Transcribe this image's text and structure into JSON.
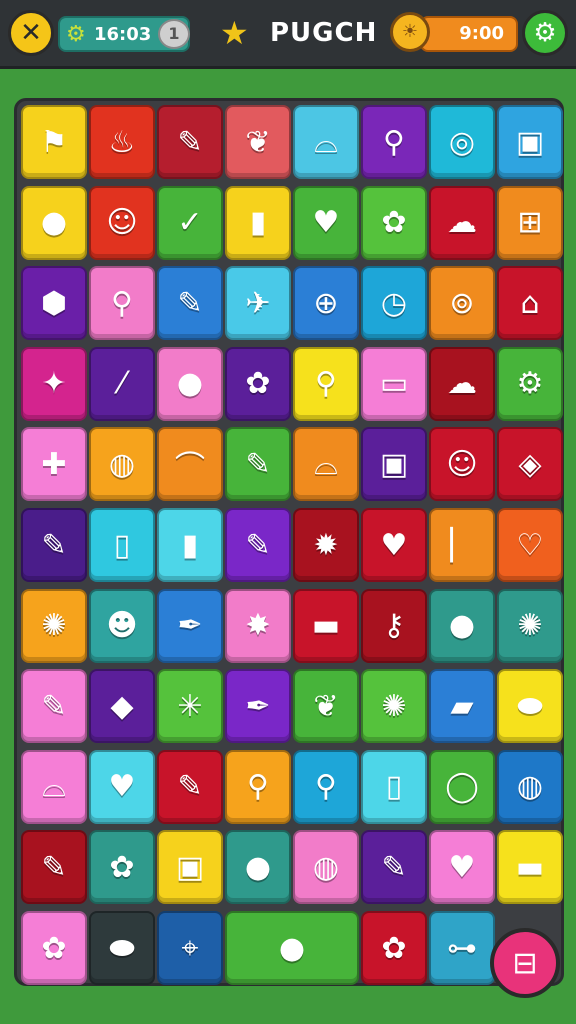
{
  "header": {
    "close_icon": "✕",
    "counter_value": "16:03",
    "counter_badge": "1",
    "title": "PUGCH",
    "timer_value": "9:00",
    "settings_icon": "⚙"
  },
  "board": {
    "rows": [
      [
        {
          "color": "#f6d21c",
          "icon": "flag-icon",
          "glyph": "⚑"
        },
        {
          "color": "#e1331f",
          "icon": "flame-icon",
          "glyph": "♨"
        },
        {
          "color": "#b51e2e",
          "icon": "pencil-icon",
          "glyph": "✎"
        },
        {
          "color": "#e25a5e",
          "icon": "leaf-icon",
          "glyph": "❦"
        },
        {
          "color": "#4cc6e4",
          "icon": "shoe-icon",
          "glyph": "⌓"
        },
        {
          "color": "#7a27b8",
          "icon": "wand-icon",
          "glyph": "⚲"
        },
        {
          "color": "#1fb9d8",
          "icon": "target-icon",
          "glyph": "◎"
        },
        {
          "color": "#2fa4e0",
          "icon": "bag-icon",
          "glyph": "▣"
        }
      ],
      [
        {
          "color": "#f6d21c",
          "icon": "paddle-icon",
          "glyph": "●"
        },
        {
          "color": "#e1331f",
          "icon": "smile-icon",
          "glyph": "☺"
        },
        {
          "color": "#47b43a",
          "icon": "check-bubble-icon",
          "glyph": "✓"
        },
        {
          "color": "#f6d21c",
          "icon": "bottle-icon",
          "glyph": "▮"
        },
        {
          "color": "#47b43a",
          "icon": "apple-icon",
          "glyph": "♥"
        },
        {
          "color": "#55c23c",
          "icon": "cup-icon",
          "glyph": "✿"
        },
        {
          "color": "#c8142a",
          "icon": "cloud-icon",
          "glyph": "☁"
        },
        {
          "color": "#f08b1e",
          "icon": "briefcase-icon",
          "glyph": "⊞"
        }
      ],
      [
        {
          "color": "#6a1fa8",
          "icon": "hexagon-icon",
          "glyph": "⬢"
        },
        {
          "color": "#f27cc9",
          "icon": "magnifier-icon",
          "glyph": "⚲"
        },
        {
          "color": "#2b7fd6",
          "icon": "pencil-icon",
          "glyph": "✎"
        },
        {
          "color": "#49c9e8",
          "icon": "carrot-icon",
          "glyph": "✈"
        },
        {
          "color": "#2b7fd6",
          "icon": "racket-icon",
          "glyph": "⊕"
        },
        {
          "color": "#1ea6d8",
          "icon": "clock-icon",
          "glyph": "◷"
        },
        {
          "color": "#f08b1e",
          "icon": "coffee-icon",
          "glyph": "⊚"
        },
        {
          "color": "#c8142a",
          "icon": "lock-icon",
          "glyph": "⌂"
        }
      ],
      [
        {
          "color": "#d4248e",
          "icon": "puzzle-icon",
          "glyph": "✦"
        },
        {
          "color": "#5b1f9a",
          "icon": "wand-icon",
          "glyph": "⁄"
        },
        {
          "color": "#f27cc9",
          "icon": "apple-icon",
          "glyph": "●"
        },
        {
          "color": "#5b1f9a",
          "icon": "flower-icon",
          "glyph": "✿"
        },
        {
          "color": "#f6e11c",
          "icon": "magnifier-icon",
          "glyph": "⚲"
        },
        {
          "color": "#f57ed6",
          "icon": "speech-bubble-icon",
          "glyph": "▭"
        },
        {
          "color": "#a8121f",
          "icon": "cloud-icon",
          "glyph": "☁"
        },
        {
          "color": "#47b43a",
          "icon": "gear-icon",
          "glyph": "⚙"
        }
      ],
      [
        {
          "color": "#f57ed6",
          "icon": "bandage-icon",
          "glyph": "✚"
        },
        {
          "color": "#f6a31c",
          "icon": "ball-icon",
          "glyph": "◍"
        },
        {
          "color": "#f08b1e",
          "icon": "swoosh-icon",
          "glyph": "⌒"
        },
        {
          "color": "#47b43a",
          "icon": "pencil-icon",
          "glyph": "✎"
        },
        {
          "color": "#f08b1e",
          "icon": "sock-icon",
          "glyph": "⌓"
        },
        {
          "color": "#5b1f9a",
          "icon": "toaster-icon",
          "glyph": "▣"
        },
        {
          "color": "#c8142a",
          "icon": "smile-icon",
          "glyph": "☺"
        },
        {
          "color": "#c8142a",
          "icon": "tag-icon",
          "glyph": "◈"
        }
      ],
      [
        {
          "color": "#4a1d8a",
          "icon": "pencil-icon",
          "glyph": "✎"
        },
        {
          "color": "#2fc8e0",
          "icon": "cup-icon",
          "glyph": "▯"
        },
        {
          "color": "#4dd6e8",
          "icon": "capsule-icon",
          "glyph": "▮"
        },
        {
          "color": "#7a27c8",
          "icon": "pencil-icon",
          "glyph": "✎"
        },
        {
          "color": "#a8121f",
          "icon": "bulb-icon",
          "glyph": "✹"
        },
        {
          "color": "#c8142a",
          "icon": "heart-icon",
          "glyph": "♥"
        },
        {
          "color": "#f08b1e",
          "icon": "pen-icon",
          "glyph": "▏"
        },
        {
          "color": "#f0601e",
          "icon": "heart-icon",
          "glyph": "♡"
        }
      ],
      [
        {
          "color": "#f6a31c",
          "icon": "gear-icon",
          "glyph": "✺"
        },
        {
          "color": "#2fa4a0",
          "icon": "face-icon",
          "glyph": "☻"
        },
        {
          "color": "#2b7fd6",
          "icon": "feather-icon",
          "glyph": "✒"
        },
        {
          "color": "#f27cc9",
          "icon": "splat-icon",
          "glyph": "✸"
        },
        {
          "color": "#c8142a",
          "icon": "folder-icon",
          "glyph": "▬"
        },
        {
          "color": "#a8121f",
          "icon": "key-icon",
          "glyph": "⚷"
        },
        {
          "color": "#2f9a8c",
          "icon": "button-icon",
          "glyph": "●"
        },
        {
          "color": "#2f9a8c",
          "icon": "sun-icon",
          "glyph": "✺"
        }
      ],
      [
        {
          "color": "#f57ed6",
          "icon": "pencil-icon",
          "glyph": "✎"
        },
        {
          "color": "#5b1f9a",
          "icon": "diamond-icon",
          "glyph": "◆"
        },
        {
          "color": "#55c23c",
          "icon": "orange-slice-icon",
          "glyph": "✳"
        },
        {
          "color": "#7a27c8",
          "icon": "pen-icon",
          "glyph": "✒"
        },
        {
          "color": "#47b43a",
          "icon": "radish-icon",
          "glyph": "❦"
        },
        {
          "color": "#55c23c",
          "icon": "sun-leaf-icon",
          "glyph": "✺"
        },
        {
          "color": "#2b7fd6",
          "icon": "eraser-icon",
          "glyph": "▰"
        },
        {
          "color": "#f6e11c",
          "icon": "pod-icon",
          "glyph": "⬬"
        }
      ],
      [
        {
          "color": "#f57ed6",
          "icon": "bird-icon",
          "glyph": "⌓"
        },
        {
          "color": "#4dd6e8",
          "icon": "heart-icon",
          "glyph": "♥"
        },
        {
          "color": "#c8142a",
          "icon": "pencil-icon",
          "glyph": "✎"
        },
        {
          "color": "#f6a31c",
          "icon": "magnifier-icon",
          "glyph": "⚲"
        },
        {
          "color": "#1ea6d8",
          "icon": "magnifier-icon",
          "glyph": "⚲"
        },
        {
          "color": "#4dd6e8",
          "icon": "bottle-icon",
          "glyph": "▯"
        },
        {
          "color": "#47b43a",
          "icon": "ring-icon",
          "glyph": "◯"
        },
        {
          "color": "#1e78c8",
          "icon": "ball-icon",
          "glyph": "◍"
        }
      ],
      [
        {
          "color": "#a8121f",
          "icon": "pencil-icon",
          "glyph": "✎"
        },
        {
          "color": "#2f9a8c",
          "icon": "flower-icon",
          "glyph": "✿"
        },
        {
          "color": "#f6d21c",
          "icon": "camera-icon",
          "glyph": "▣"
        },
        {
          "color": "#2f9a8c",
          "icon": "leaf-icon",
          "glyph": "●"
        },
        {
          "color": "#f27cc9",
          "icon": "ball-icon",
          "glyph": "◍"
        },
        {
          "color": "#5b1f9a",
          "icon": "pencil-icon",
          "glyph": "✎"
        },
        {
          "color": "#f57ed6",
          "icon": "heart-box-icon",
          "glyph": "♥"
        },
        {
          "color": "#f6e11c",
          "icon": "hat-icon",
          "glyph": "▬"
        }
      ],
      [
        {
          "color": "#f57ed6",
          "icon": "flower-icon",
          "glyph": "✿"
        },
        {
          "color": "#2e3a3c",
          "icon": "pea-icon",
          "glyph": "⬬"
        },
        {
          "color": "#1e5fa8",
          "icon": "pin-icon",
          "glyph": "⌖"
        },
        {
          "color": "#47b43a",
          "icon": "apple-icon",
          "glyph": "●",
          "wide": true
        },
        {
          "color": "#47b43a",
          "icon": "apple-icon",
          "glyph": "♥",
          "hidden": true
        },
        {
          "color": "#c8142a",
          "icon": "flower-icon",
          "glyph": "✿"
        },
        {
          "color": "#2fa4c8",
          "icon": "bone-icon",
          "glyph": "⊶"
        }
      ]
    ]
  },
  "fab": {
    "icon": "toggle-icon",
    "glyph": "⊟"
  }
}
